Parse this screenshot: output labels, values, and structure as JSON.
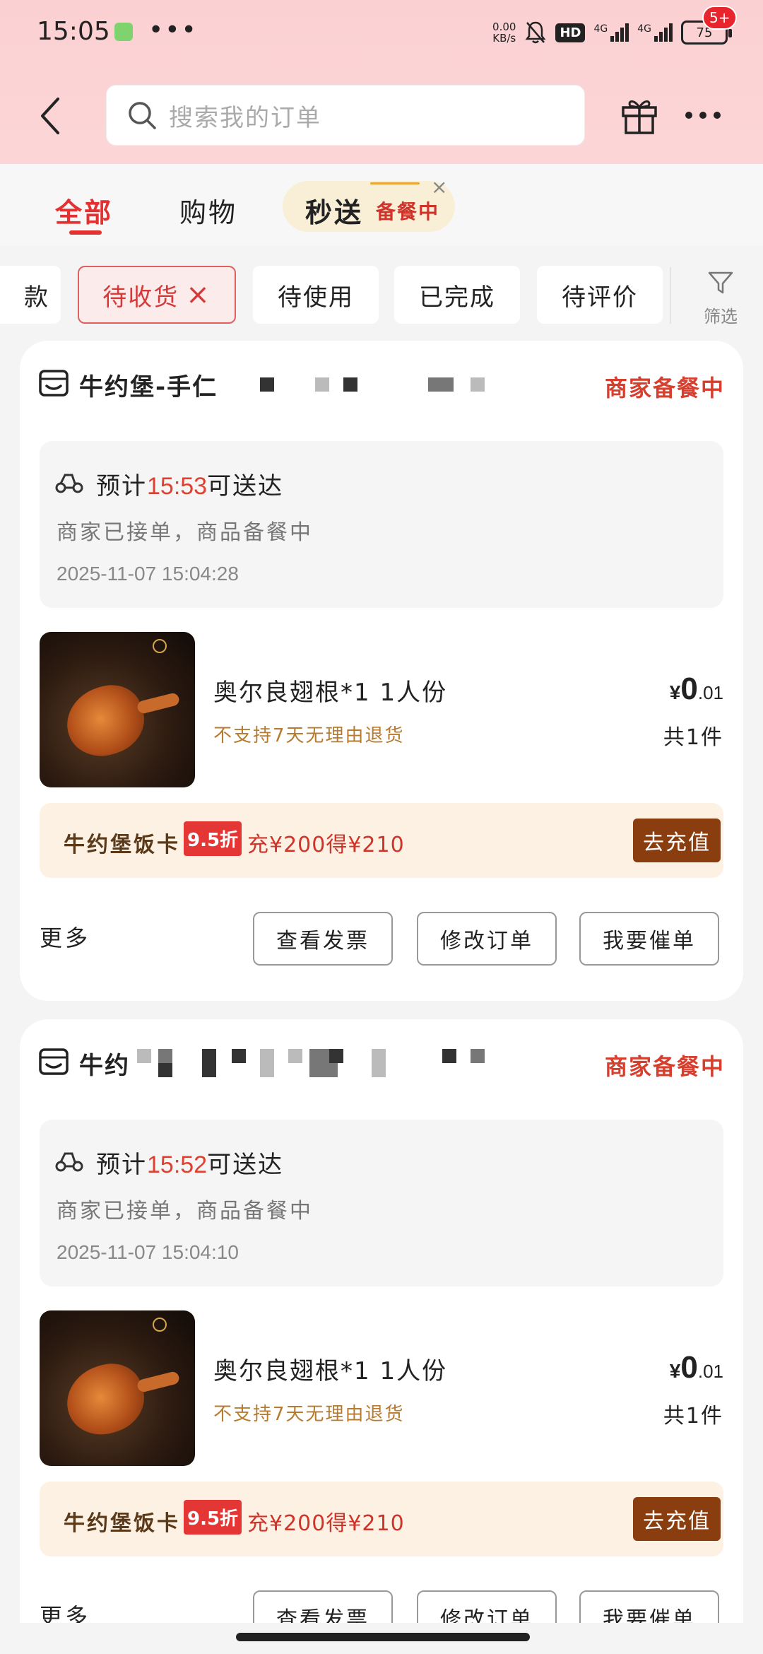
{
  "status_bar": {
    "time": "15:05",
    "dots": "•••",
    "speed_value": "0.00",
    "speed_unit": "KB/s",
    "hd": "HD",
    "net1": "4G",
    "net2": "4G",
    "battery": "75"
  },
  "search": {
    "placeholder": "搜索我的订单"
  },
  "header": {
    "badge": "5+"
  },
  "tabs": {
    "all": "全部",
    "shopping": "购物",
    "flash": "秒送",
    "flash_status": "备餐中",
    "flash_close": "×"
  },
  "filters": {
    "partial": "款",
    "pending_receipt": "待收货",
    "pending_use": "待使用",
    "completed": "已完成",
    "pending_review": "待评价",
    "filter_label": "筛选",
    "clear": "×"
  },
  "orders": [
    {
      "shop_name": "牛约堡-手仁",
      "status": "商家备餐中",
      "eta_prefix": "预计",
      "eta_time": "15:53",
      "eta_suffix": "可送达",
      "note": "商家已接单，商品备餐中",
      "timestamp": "2025-11-07 15:04:28",
      "product_name": "奥尔良翅根*1 1人份",
      "policy": "不支持7天无理由退货",
      "price_currency": "¥",
      "price_int": "0",
      "price_dec": ".01",
      "quantity": "共1件",
      "promo_name": "牛约堡饭卡",
      "promo_tag": "9.5折",
      "promo_offer": "充¥200得¥210",
      "promo_button": "去充值",
      "more": "更多",
      "btn_invoice": "查看发票",
      "btn_modify": "修改订单",
      "btn_urge": "我要催单"
    },
    {
      "shop_name": "牛约",
      "status": "商家备餐中",
      "eta_prefix": "预计",
      "eta_time": "15:52",
      "eta_suffix": "可送达",
      "note": "商家已接单，商品备餐中",
      "timestamp": "2025-11-07 15:04:10",
      "product_name": "奥尔良翅根*1 1人份",
      "policy": "不支持7天无理由退货",
      "price_currency": "¥",
      "price_int": "0",
      "price_dec": ".01",
      "quantity": "共1件",
      "promo_name": "牛约堡饭卡",
      "promo_tag": "9.5折",
      "promo_offer": "充¥200得¥210",
      "promo_button": "去充值",
      "more": "更多",
      "btn_invoice": "查看发票",
      "btn_modify": "修改订单",
      "btn_urge": "我要催单"
    }
  ]
}
